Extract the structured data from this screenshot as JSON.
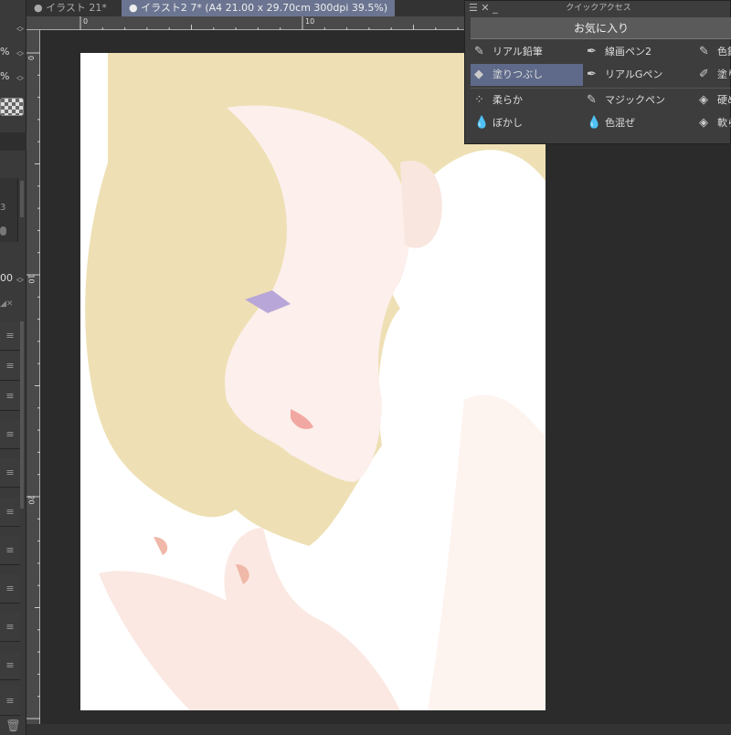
{
  "tabs": [
    {
      "label": "● イラスト 21*"
    },
    {
      "label": "● イラスト2 7* (A4 21.00 x 29.70cm 300dpi 39.5%)"
    }
  ],
  "ruler": {
    "top_labels": [
      "0",
      "10"
    ],
    "left_labels": [
      "0",
      "10",
      "20"
    ]
  },
  "left_panel": {
    "value_a": "%",
    "value_b": "%",
    "value_c": "3",
    "value_d": "00",
    "layer_menu_icon": "≡"
  },
  "quick_access": {
    "title": "クイックアクセス",
    "set_name": "お気に入り",
    "items": [
      {
        "label": "リアル鉛筆",
        "icon": "pencil-icon"
      },
      {
        "label": "線画ペン2",
        "icon": "pen-icon"
      },
      {
        "label": "色鉛",
        "icon": "pencil-icon"
      },
      {
        "label": "塗りつぶし",
        "icon": "fill-icon",
        "selected": true
      },
      {
        "label": "リアルGペン",
        "icon": "pen-icon"
      },
      {
        "label": "塗り",
        "icon": "brush-icon"
      },
      {
        "label": "柔らか",
        "icon": "airbrush-icon"
      },
      {
        "label": "マジックペン",
        "icon": "marker-icon"
      },
      {
        "label": "硬め",
        "icon": "eraser-icon"
      },
      {
        "label": "ぼかし",
        "icon": "blend-icon"
      },
      {
        "label": "色混ぜ",
        "icon": "blend-icon"
      },
      {
        "label": "軟ら",
        "icon": "eraser-icon"
      }
    ]
  },
  "colors": {
    "accent": "#6b7591",
    "hair": "#eee0b4",
    "skin": "#fbe9e4"
  }
}
